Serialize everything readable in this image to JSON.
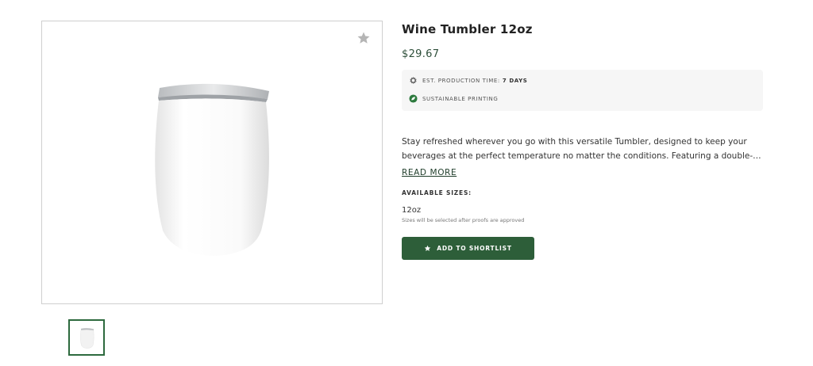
{
  "product": {
    "title": "Wine Tumbler 12oz",
    "price": "$29.67",
    "production_label": "EST. PRODUCTION TIME:",
    "production_value": "7 DAYS",
    "sustainable_label": "SUSTAINABLE PRINTING",
    "description": "Stay refreshed wherever you go with this versatile Tumbler, designed to keep your beverages at the perfect temperature no matter the conditions. Featuring a double-…",
    "read_more": "READ MORE",
    "sizes_label": "AVAILABLE SIZES:",
    "size_value": "12oz",
    "size_note": "Sizes will be selected after proofs are approved",
    "shortlist_button": "ADD TO SHORTLIST"
  },
  "icons": {
    "favorite": "star-icon",
    "production": "gear-icon",
    "sustainable": "leaf-icon",
    "shortlist": "star-icon"
  },
  "colors": {
    "brand_green": "#2d5e39",
    "price_text": "#2e4f3a",
    "info_bg": "#f6f6f6"
  }
}
